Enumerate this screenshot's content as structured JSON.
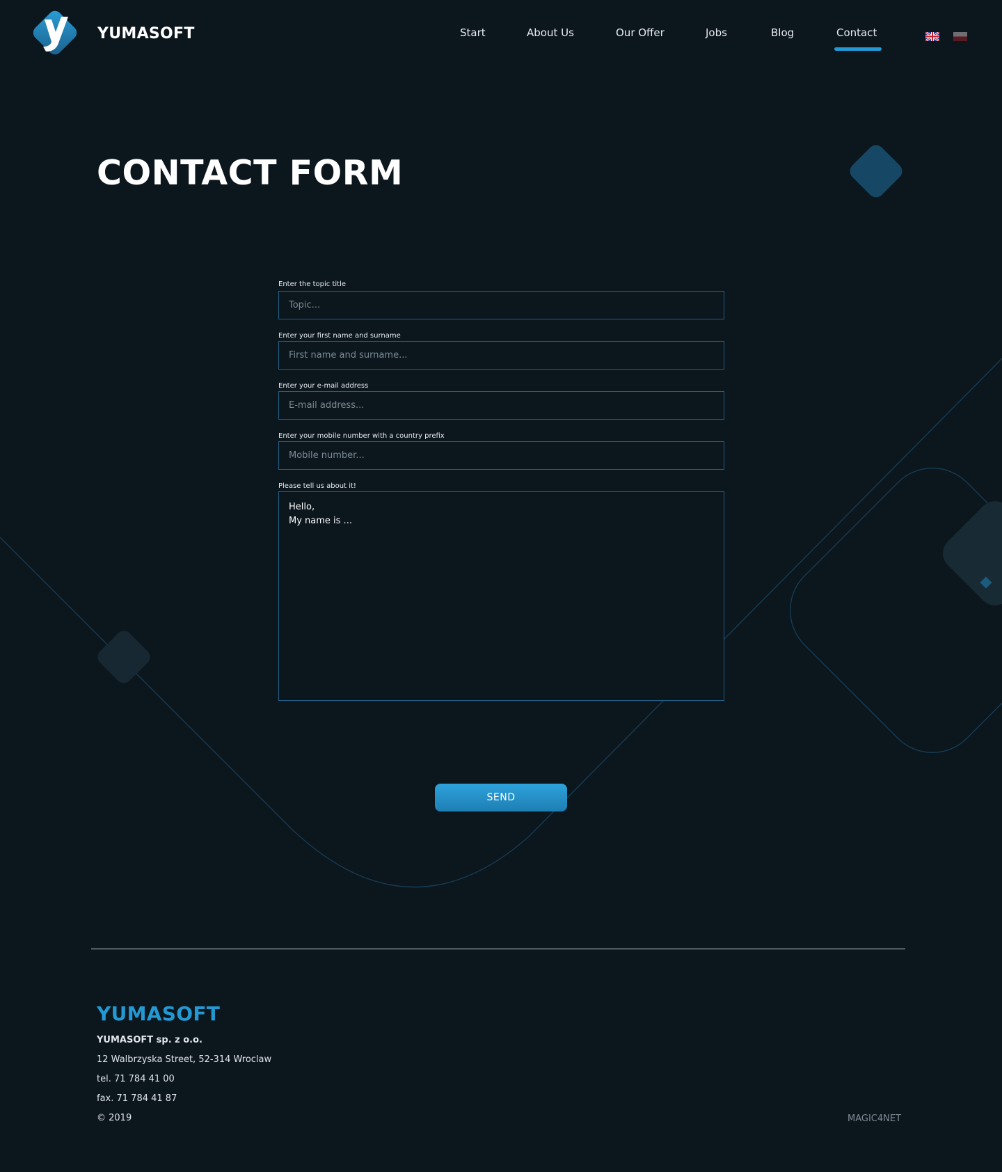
{
  "header": {
    "brand": "YUMASOFT",
    "nav": [
      {
        "label": "Start"
      },
      {
        "label": "About Us"
      },
      {
        "label": "Our Offer"
      },
      {
        "label": "Jobs"
      },
      {
        "label": "Blog"
      },
      {
        "label": "Contact",
        "active": true
      }
    ],
    "languages": [
      "uk-flag-icon",
      "pl-flag-icon"
    ],
    "accent_color": "#2399d4"
  },
  "main": {
    "title": "CONTACT FORM",
    "form": {
      "topic": {
        "label": "Enter the topic title",
        "placeholder": "Topic...",
        "value": ""
      },
      "name": {
        "label": "Enter your first name and surname",
        "placeholder": "First name and surname...",
        "value": ""
      },
      "email": {
        "label": "Enter your e-mail address",
        "placeholder": "E-mail address...",
        "value": ""
      },
      "mobile": {
        "label": "Enter your mobile number with a country prefix",
        "placeholder": "Mobile number...",
        "value": ""
      },
      "message": {
        "label": "Please tell us about it!",
        "value": "Hello,\nMy name is ..."
      },
      "send_label": "SEND"
    }
  },
  "footer": {
    "brand": "YUMASOFT",
    "company": "YUMASOFT sp. z o.o.",
    "address": "12 Walbrzyska Street, 52-314 Wroclaw",
    "tel": "tel. 71 784 41 00",
    "fax": "fax. 71 784 41 87",
    "copyright": "© 2019",
    "credit": "MAGIC4NET"
  },
  "colors": {
    "background": "#0c161d",
    "accent": "#2399d4",
    "field_border": "#1f5f87"
  }
}
